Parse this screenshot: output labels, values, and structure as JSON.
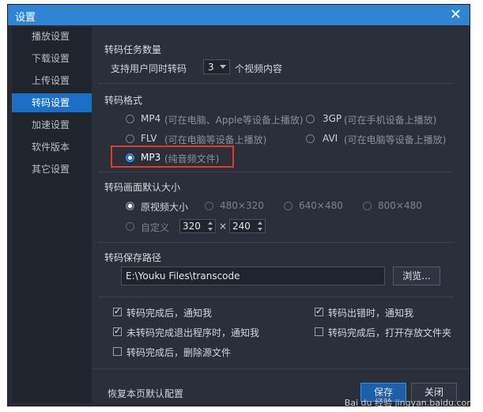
{
  "window": {
    "title": "设置"
  },
  "sidebar": {
    "items": [
      {
        "label": "播放设置"
      },
      {
        "label": "下载设置"
      },
      {
        "label": "上传设置"
      },
      {
        "label": "转码设置"
      },
      {
        "label": "加速设置"
      },
      {
        "label": "软件版本"
      },
      {
        "label": "其它设置"
      }
    ],
    "active_index": 3
  },
  "count": {
    "title": "转码任务数量",
    "prefix": "支持用户同时转码",
    "value": "3",
    "suffix": "个视频内容"
  },
  "format": {
    "title": "转码格式",
    "options": [
      {
        "name": "MP4",
        "note": "(可在电脑、Apple等设备上播放)"
      },
      {
        "name": "3GP",
        "note": "(可在手机设备上播放)"
      },
      {
        "name": "FLV",
        "note": "(可在电脑等设备上播放)"
      },
      {
        "name": "AVI",
        "note": "(可在电脑等设备上播放)"
      },
      {
        "name": "MP3",
        "note": "(纯音频文件)"
      }
    ],
    "selected": "MP3"
  },
  "size": {
    "title": "转码画面默认大小",
    "options": [
      "原视频大小",
      "480×320",
      "640×480",
      "800×480"
    ],
    "selected": "原视频大小",
    "custom_label": "自定义",
    "width": "320",
    "times": "×",
    "height": "240"
  },
  "path": {
    "title": "转码保存路径",
    "value": "E:\\Youku Files\\transcode",
    "browse": "浏览..."
  },
  "options": [
    {
      "label": "转码完成后，通知我",
      "checked": true
    },
    {
      "label": "转码出错时，通知我",
      "checked": true
    },
    {
      "label": "未转码完成退出程序时，通知我",
      "checked": true
    },
    {
      "label": "转码完成后，打开存放文件夹",
      "checked": false
    },
    {
      "label": "转码完成后，删除源文件",
      "checked": false
    }
  ],
  "footer": {
    "restore": "恢复本页默认配置",
    "save": "保存",
    "close": "关闭"
  },
  "watermark": "Bai du 经验 jingyan.baidu.com",
  "colors": {
    "accent": "#2f85d3",
    "highlight": "#e43a2a"
  }
}
